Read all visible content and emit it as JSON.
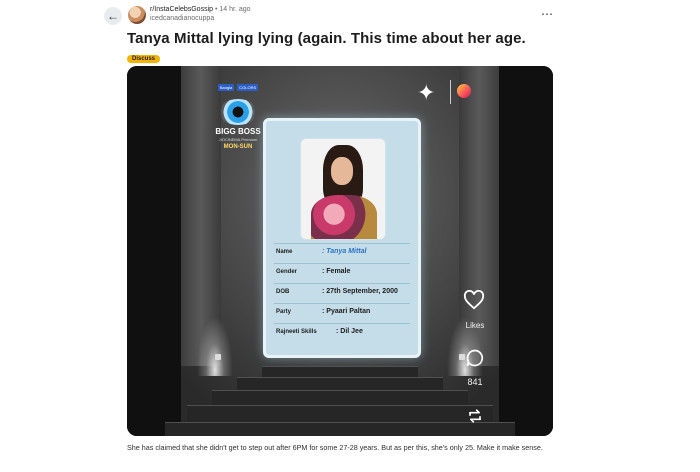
{
  "header": {
    "subreddit": "r/InstaCelebsGossip",
    "separator": "•",
    "time": "14 hr. ago",
    "username": "icedcanadianocuppa",
    "more_icon": "more-horizontal-icon",
    "back_icon": "arrow-left-icon"
  },
  "post": {
    "title": "Tanya Mittal lying lying (again. This time about her age.",
    "flair": "Discuss",
    "body": "She has claimed that she didn't get to step out after 6PM for some 27-28 years. But as per this, she's only 25. Make it make sense."
  },
  "media": {
    "show_logo": {
      "title": "BIGG BOSS",
      "badge_left": "Bangla",
      "badge_right": "COLORS",
      "schedule": "MON-SUN",
      "small_text": "JIOCINEMA Premium"
    },
    "id_card": {
      "fields": [
        {
          "label": "Name",
          "value": ": Tanya Mittal"
        },
        {
          "label": "Gender",
          "value": ": Female"
        },
        {
          "label": "DOB",
          "value": ": 27th September, 2000"
        },
        {
          "label": "Party",
          "value": ": Pyaari Paltan"
        },
        {
          "label": "Rajneeti Skills",
          "value": ": Dil Jee"
        }
      ]
    },
    "actions": {
      "likes_label": "Likes",
      "comments_count": "841"
    },
    "icons": {
      "star": "sparkle-star-icon",
      "jio": "jiocinema-icon",
      "like": "heart-icon",
      "comment": "comment-icon",
      "share": "repost-icon"
    }
  },
  "colors": {
    "flair_bg": "#f5b400",
    "name_value": "#2d74c8"
  }
}
